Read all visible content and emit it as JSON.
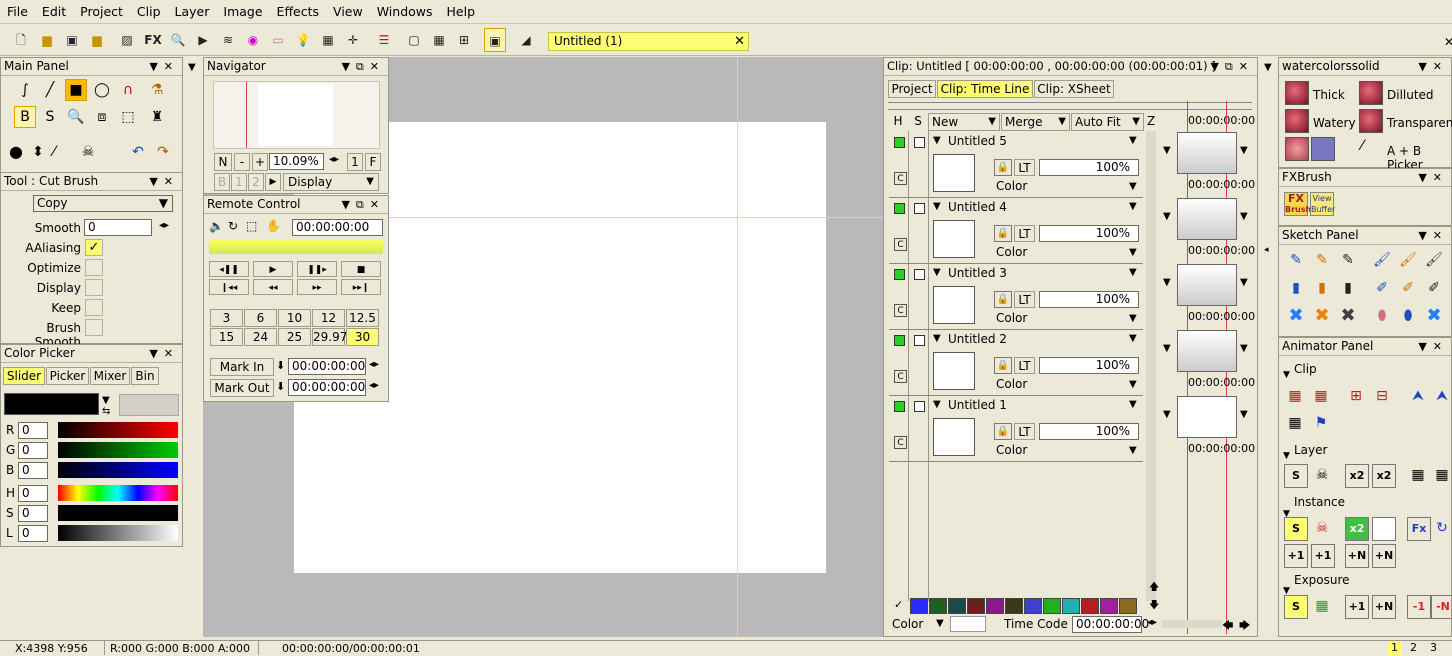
{
  "menu": [
    "File",
    "Edit",
    "Project",
    "Clip",
    "Layer",
    "Image",
    "Effects",
    "View",
    "Windows",
    "Help"
  ],
  "toolbar": {
    "fx_label": "FX",
    "doc_tab": "Untitled (1)"
  },
  "main_panel": {
    "title": "Main Panel"
  },
  "tool_panel": {
    "title": "Tool : Cut Brush",
    "mode": "Copy",
    "smooth_label": "Smooth",
    "smooth_value": "0",
    "aaliasing_label": "AAliasing",
    "optimize_label": "Optimize",
    "display_label": "Display",
    "keep_label": "Keep",
    "brush_smooth_label": "Brush Smooth"
  },
  "color_picker": {
    "title": "Color Picker",
    "tabs": [
      "Slider",
      "Picker",
      "Mixer",
      "Bin"
    ],
    "channels": [
      {
        "name": "R",
        "value": "0"
      },
      {
        "name": "G",
        "value": "0"
      },
      {
        "name": "B",
        "value": "0"
      },
      {
        "name": "H",
        "value": "0"
      },
      {
        "name": "S",
        "value": "0"
      },
      {
        "name": "L",
        "value": "0"
      }
    ]
  },
  "navigator": {
    "title": "Navigator",
    "n": "N",
    "minus": "-",
    "plus": "+",
    "zoom": "10.09%",
    "one": "1",
    "f": "F",
    "b": "B",
    "b1": "1",
    "b2": "2",
    "display": "Display"
  },
  "remote": {
    "title": "Remote Control",
    "timecode": "00:00:00:00",
    "fps_row1": [
      "3",
      "6",
      "10",
      "12",
      "12.5"
    ],
    "fps_row2": [
      "15",
      "24",
      "25",
      "29.97",
      "30"
    ],
    "mark_in": "Mark In",
    "mark_in_value": "00:00:00:00",
    "mark_out": "Mark Out",
    "mark_out_value": "00:00:00:00"
  },
  "clip_panel": {
    "title": "Clip: Untitled [ 00:00:00:00 , 00:00:00:00  (00:00:00:01) ]",
    "tabs": [
      "Project",
      "Clip: Time Line",
      "Clip: XSheet"
    ],
    "h": "H",
    "s": "S",
    "new": "New",
    "merge": "Merge",
    "autofit": "Auto Fit",
    "z": "Z",
    "top_timecode": "00:00:00:00",
    "layers": [
      {
        "name": "Untitled 5",
        "opacity": "100%",
        "mode": "Color",
        "lt": "LT",
        "c": "C",
        "timecode": "00:00:00:00"
      },
      {
        "name": "Untitled 4",
        "opacity": "100%",
        "mode": "Color",
        "lt": "LT",
        "c": "C",
        "timecode": "00:00:00:00"
      },
      {
        "name": "Untitled 3",
        "opacity": "100%",
        "mode": "Color",
        "lt": "LT",
        "c": "C",
        "timecode": "00:00:00:00"
      },
      {
        "name": "Untitled 2",
        "opacity": "100%",
        "mode": "Color",
        "lt": "LT",
        "c": "C",
        "timecode": "00:00:00:00"
      },
      {
        "name": "Untitled 1",
        "opacity": "100%",
        "mode": "Color",
        "lt": "LT",
        "c": "C",
        "timecode": "00:00:00:00"
      }
    ],
    "color_label": "Color",
    "timecode_label": "Time Code",
    "timecode_value": "00:00:00:00",
    "swatches": [
      "#2a2aff",
      "#1f5f1f",
      "#1a4a4a",
      "#6b2020",
      "#8a1a8a",
      "#3a3a1a",
      "#4040d0",
      "#20b020",
      "#20b0b0",
      "#b02020",
      "#a020a0",
      "#8a6a20"
    ]
  },
  "brush_panel": {
    "title": "watercolorssolid",
    "items": [
      "Thick",
      "Dilluted",
      "Watery",
      "Transparent",
      "A + B Picker"
    ]
  },
  "fxbrush": {
    "title": "FXBrush",
    "fx": "FX",
    "brush": "Brush",
    "view": "View",
    "buffer": "Buffer"
  },
  "sketch": {
    "title": "Sketch Panel"
  },
  "animator": {
    "title": "Animator Panel",
    "clip": "Clip",
    "layer": "Layer",
    "instance": "Instance",
    "exposure": "Exposure",
    "s": "S",
    "x2": "x2",
    "fx": "Fx",
    "p1": "+1",
    "pn": "+N",
    "m1": "-1",
    "mn": "-N",
    "p1b": "+1",
    "pnb": "+N"
  },
  "status": {
    "xy": "X:4398  Y:956",
    "rgba": "R:000 G:000 B:000 A:000",
    "time": "00:00:00:00/00:00:00:01",
    "pages": [
      "1",
      "2",
      "3"
    ]
  },
  "colors": {
    "accent": "#fdfd73",
    "bg": "#ece9d8",
    "canvas": "#b9b9b9"
  }
}
